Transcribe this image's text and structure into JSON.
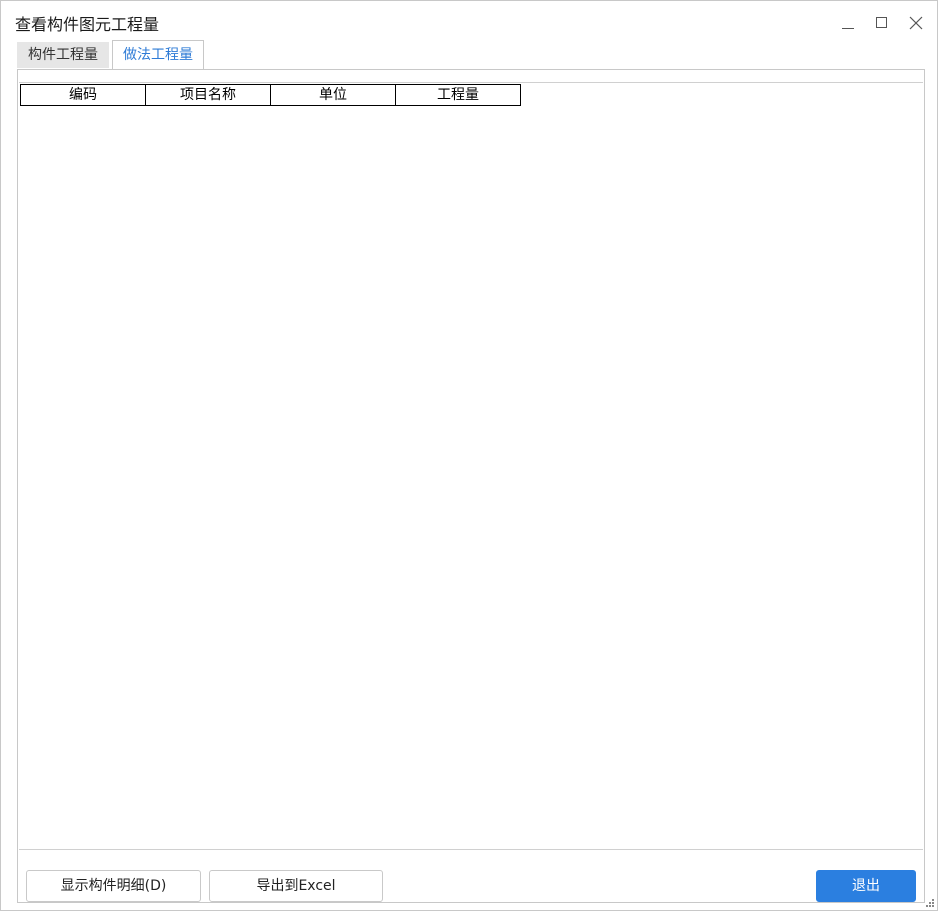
{
  "window": {
    "title": "查看构件图元工程量",
    "controls": {
      "minimize": "minimize-icon",
      "maximize": "maximize-icon",
      "close": "close-icon"
    }
  },
  "tabs": [
    {
      "label": "构件工程量",
      "active": false
    },
    {
      "label": "做法工程量",
      "active": true
    }
  ],
  "table": {
    "columns": [
      "编码",
      "项目名称",
      "单位",
      "工程量"
    ],
    "rows": []
  },
  "footer": {
    "detail_button": "显示构件明细(D)",
    "export_button": "导出到Excel",
    "exit_button": "退出"
  },
  "colors": {
    "accent": "#2b7fe0",
    "active_tab_text": "#2e7bd6",
    "inactive_tab_bg": "#e6e6e6"
  }
}
